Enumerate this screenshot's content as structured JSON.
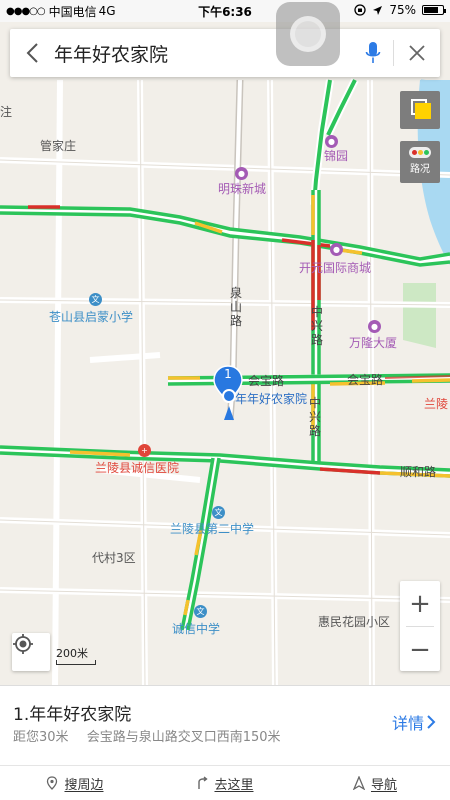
{
  "status_bar": {
    "signal": "●●●○○",
    "carrier": "中国电信",
    "network": "4G",
    "time": "下午6:36",
    "battery": "75%",
    "battery_level": 0.75
  },
  "search": {
    "query": "年年好农家院"
  },
  "map": {
    "places": {
      "guanjiazhuang": "管家庄",
      "jinyuan": "锦园",
      "mingzhu": "明珠新城",
      "kaiyuan": "开元国际商城",
      "qimeng": "苍山县启蒙小学",
      "wanlong": "万隆大厦",
      "chengxin_hospital": "兰陵县诚信医院",
      "dicun": "代村3区",
      "second_middle": "兰陵县第二中学",
      "chengxin_middle": "诚信中学",
      "huimin": "惠民花园小区",
      "lanling_partial": "兰陵",
      "zhu_partial": "注"
    },
    "roads": {
      "quanshan": "泉山路",
      "zhongxing": "中兴路",
      "huibao_1": "会宝路",
      "huibao_2": "会宝路",
      "shunhe": "顺和路"
    },
    "marker_number": "1",
    "marker_label": "年年好农家院",
    "traffic_label": "路况",
    "scale": "200米",
    "zoom_in": "+",
    "zoom_out": "−"
  },
  "result": {
    "title": "1.年年好农家院",
    "distance": "距您30米",
    "address": "会宝路与泉山路交叉口西南150米",
    "details": "详情"
  },
  "actions": {
    "nearby": "搜周边",
    "go_here": "去这里",
    "navigate": "导航"
  },
  "colors": {
    "traffic_green": "#2cc45a",
    "traffic_yellow": "#f5c12e",
    "traffic_red": "#d9302a",
    "accent": "#2d7be5",
    "river": "#a8d8f0",
    "park": "#c9e8c0"
  }
}
